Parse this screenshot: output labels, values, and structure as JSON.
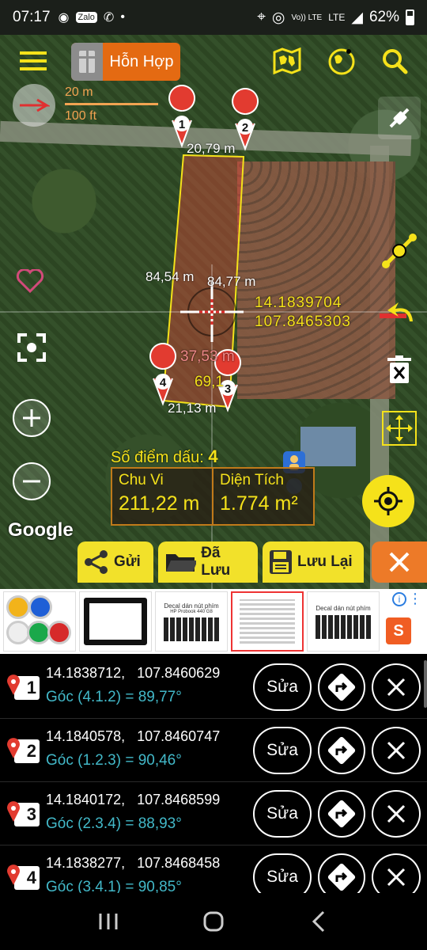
{
  "status_bar": {
    "time": "07:17",
    "left_icons": [
      "messenger-icon",
      "zalo-icon",
      "call-icon",
      "dot-icon"
    ],
    "network_label": "Vo)) LTE",
    "lte_label": "LTE",
    "battery": "62%"
  },
  "map": {
    "map_type_label": "Hỗn Hợp",
    "scale_metric": "20 m",
    "scale_imperial": "100 ft",
    "edge_top": "20,79 m",
    "edge_left": "84,54 m",
    "edge_right": "84,77 m",
    "edge_bottom": "21,13 m",
    "center_distance": "37,53 m",
    "center_angle": "69,1",
    "cursor_lat": "14.1839704",
    "cursor_lng": "107.8465303",
    "markers": [
      "1",
      "2",
      "3",
      "4"
    ],
    "point_count_label": "Số điểm dấu:",
    "point_count": "4",
    "perimeter_label": "Chu Vi",
    "perimeter_value": "211,22 m",
    "area_label": "Diện Tích",
    "area_value": "1.774 m²",
    "google_label": "Google",
    "accent_color": "#f5e21a",
    "orange_color": "#e46a12"
  },
  "actions": {
    "send_label": "Gửi",
    "saved_label": "Đã Lưu",
    "save_label": "Lưu Lại"
  },
  "ad": {
    "item_2_title": "Decal dán nút phím",
    "item_2_sub": "HP Probook 440 G8",
    "item_4_title": "Decal dán nút phím",
    "info_label": "i",
    "shop_label": "S"
  },
  "points": [
    {
      "num": "1",
      "coords": "14.1838712,   107.8460629",
      "angle": "Góc (4.1.2) = 89,77°",
      "edit": "Sửa"
    },
    {
      "num": "2",
      "coords": "14.1840578,   107.8460747",
      "angle": "Góc (1.2.3) = 90,46°",
      "edit": "Sửa"
    },
    {
      "num": "3",
      "coords": "14.1840172,   107.8468599",
      "angle": "Góc (2.3.4) = 88,93°",
      "edit": "Sửa"
    },
    {
      "num": "4",
      "coords": "14.1838277,   107.8468458",
      "angle": "Góc (3.4.1) = 90,85°",
      "edit": "Sửa"
    }
  ]
}
